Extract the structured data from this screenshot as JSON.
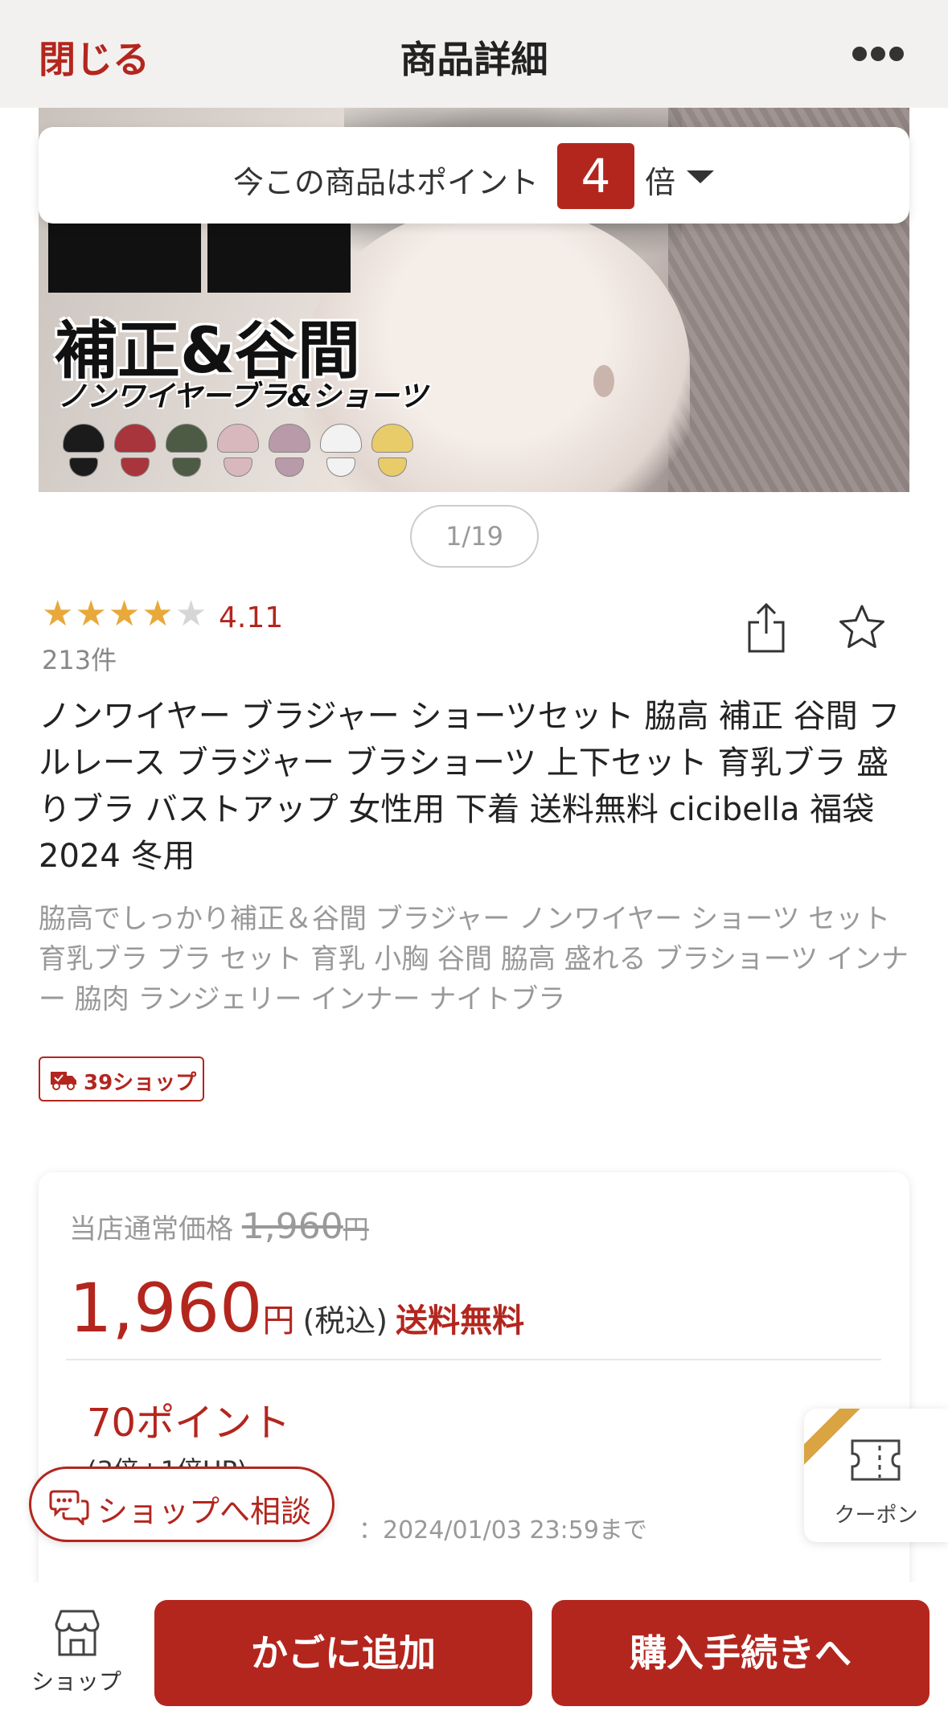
{
  "header": {
    "close_label": "閉じる",
    "title": "商品詳細",
    "more_icon": "more-horizontal-icon"
  },
  "hero": {
    "big_text": "補正&谷間",
    "sub_text": "ノンワイヤーブラ&ショーツ",
    "swatch_colors": [
      "#1b1b1b",
      "#a8343c",
      "#4d5a44",
      "#d9b8bd",
      "#b89aa8",
      "#f2f2f2",
      "#e8cc6a"
    ]
  },
  "points_banner": {
    "prefix": "今この商品はポイント",
    "multiplier": "4",
    "suffix": "倍"
  },
  "gallery": {
    "counter": "1/19"
  },
  "rating": {
    "stars": 4,
    "score": "4.11",
    "count": "213件"
  },
  "product": {
    "title": "ノンワイヤー ブラジャー ショーツセット 脇高 補正 谷間 フルレース ブラジャー ブラショーツ 上下セット 育乳ブラ 盛りブラ バストアップ 女性用 下着 送料無料 cicibella 福袋2024 冬用",
    "catch_copy": "脇高でしっかり補正＆谷間 ブラジャー ノンワイヤー ショーツ セット 育乳ブラ ブラ セット 育乳 小胸 谷間 脇高 盛れる ブラショーツ インナー 脇肉 ランジェリー インナー ナイトブラ"
  },
  "badge": {
    "shop39": "39ショップ"
  },
  "price": {
    "regular_label": "当店通常価格",
    "regular_value": "1,960",
    "yen": "円",
    "current": "1,960",
    "tax": "(税込)",
    "shipping": "送料無料",
    "points": "70ポイント",
    "points_detail": "(3倍+1倍UP)",
    "deadline": "：2024/01/03 23:59まで"
  },
  "consult": {
    "label": "ショップへ相談"
  },
  "coupon": {
    "label": "クーポン"
  },
  "bottom_bar": {
    "shop_label": "ショップ",
    "cart_label": "かごに追加",
    "buy_label": "購入手続きへ"
  },
  "colors": {
    "accent": "#b3261e",
    "star": "#e8a93a",
    "ribbon": "#d9a441"
  }
}
